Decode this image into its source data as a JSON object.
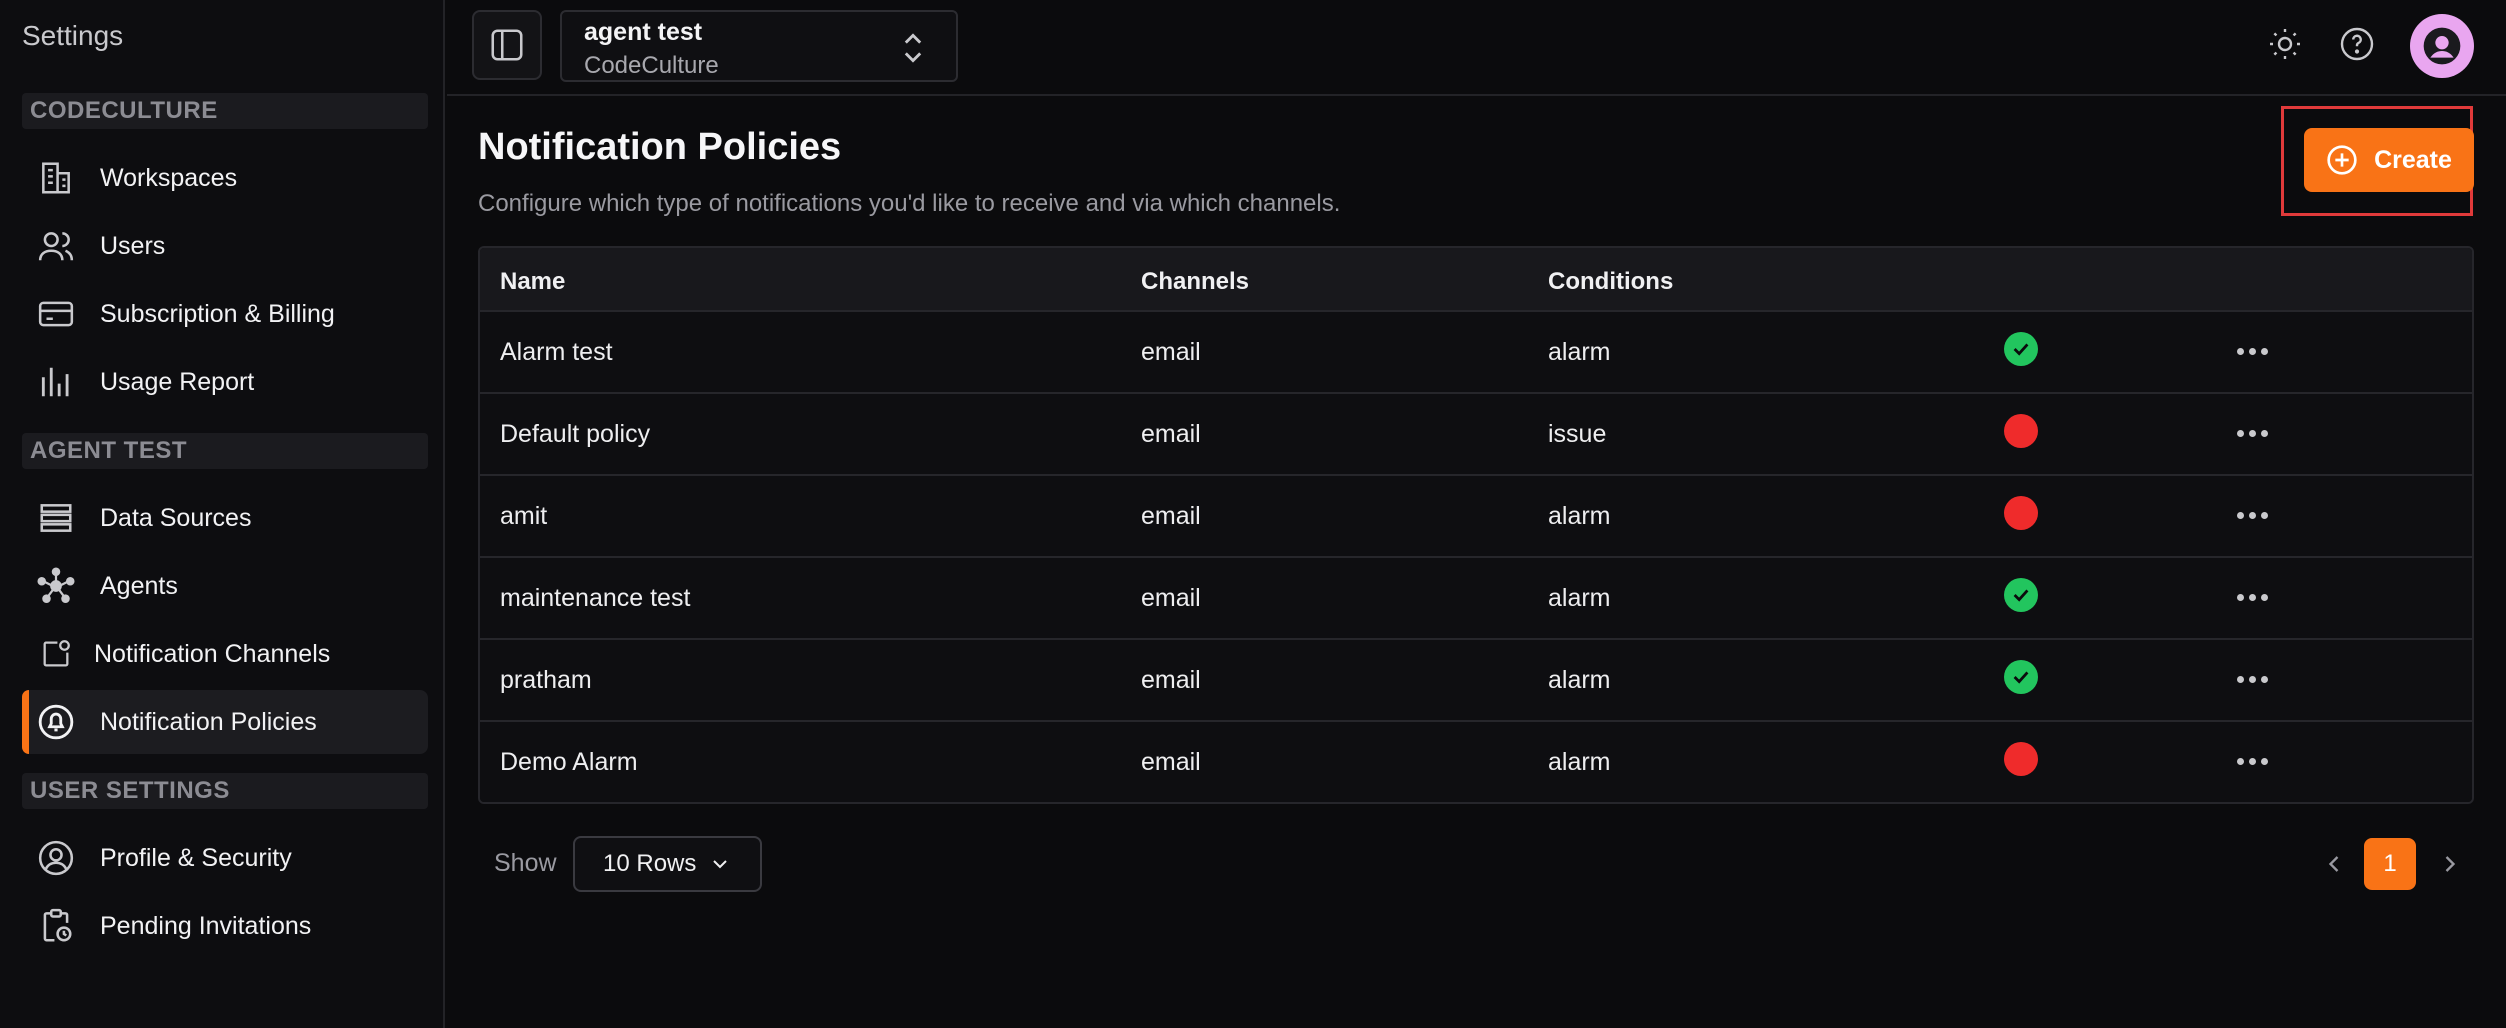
{
  "sidebar": {
    "title": "Settings",
    "sections": [
      {
        "header": "CODECULTURE",
        "items": [
          {
            "label": "Workspaces",
            "icon": "building-icon"
          },
          {
            "label": "Users",
            "icon": "users-icon"
          },
          {
            "label": "Subscription & Billing",
            "icon": "credit-card-icon"
          },
          {
            "label": "Usage Report",
            "icon": "bar-chart-icon"
          }
        ]
      },
      {
        "header": "AGENT TEST",
        "items": [
          {
            "label": "Data Sources",
            "icon": "database-list-icon"
          },
          {
            "label": "Agents",
            "icon": "network-nodes-icon"
          },
          {
            "label": "Notification Channels",
            "icon": "notification-square-icon"
          },
          {
            "label": "Notification Policies",
            "icon": "bell-circle-icon",
            "active": true
          }
        ]
      },
      {
        "header": "USER SETTINGS",
        "items": [
          {
            "label": "Profile & Security",
            "icon": "user-circle-icon"
          },
          {
            "label": "Pending Invitations",
            "icon": "clipboard-clock-icon"
          }
        ]
      }
    ]
  },
  "topbar": {
    "workspace_name": "agent test",
    "organization": "CodeCulture",
    "icons": [
      "sidebar-toggle-icon",
      "sun-icon",
      "help-icon",
      "user-avatar-icon"
    ]
  },
  "page": {
    "title": "Notification Policies",
    "subtitle": "Configure which type of notifications you'd like to receive and via which channels.",
    "create_label": "Create"
  },
  "table": {
    "columns": [
      "Name",
      "Channels",
      "Conditions"
    ],
    "rows": [
      {
        "name": "Alarm test",
        "channels": "email",
        "conditions": "alarm",
        "enabled": true
      },
      {
        "name": "Default policy",
        "channels": "email",
        "conditions": "issue",
        "enabled": false
      },
      {
        "name": "amit",
        "channels": "email",
        "conditions": "alarm",
        "enabled": false
      },
      {
        "name": "maintenance test",
        "channels": "email",
        "conditions": "alarm",
        "enabled": true
      },
      {
        "name": "pratham",
        "channels": "email",
        "conditions": "alarm",
        "enabled": true
      },
      {
        "name": "Demo Alarm",
        "channels": "email",
        "conditions": "alarm",
        "enabled": false
      }
    ]
  },
  "footer": {
    "show_label": "Show",
    "rows_per_page": "10 Rows",
    "current_page": "1"
  },
  "colors": {
    "accent": "#f97316",
    "status_enabled": "#22c55e",
    "status_disabled": "#ef2b2b",
    "highlight_box": "#e03a3a"
  }
}
